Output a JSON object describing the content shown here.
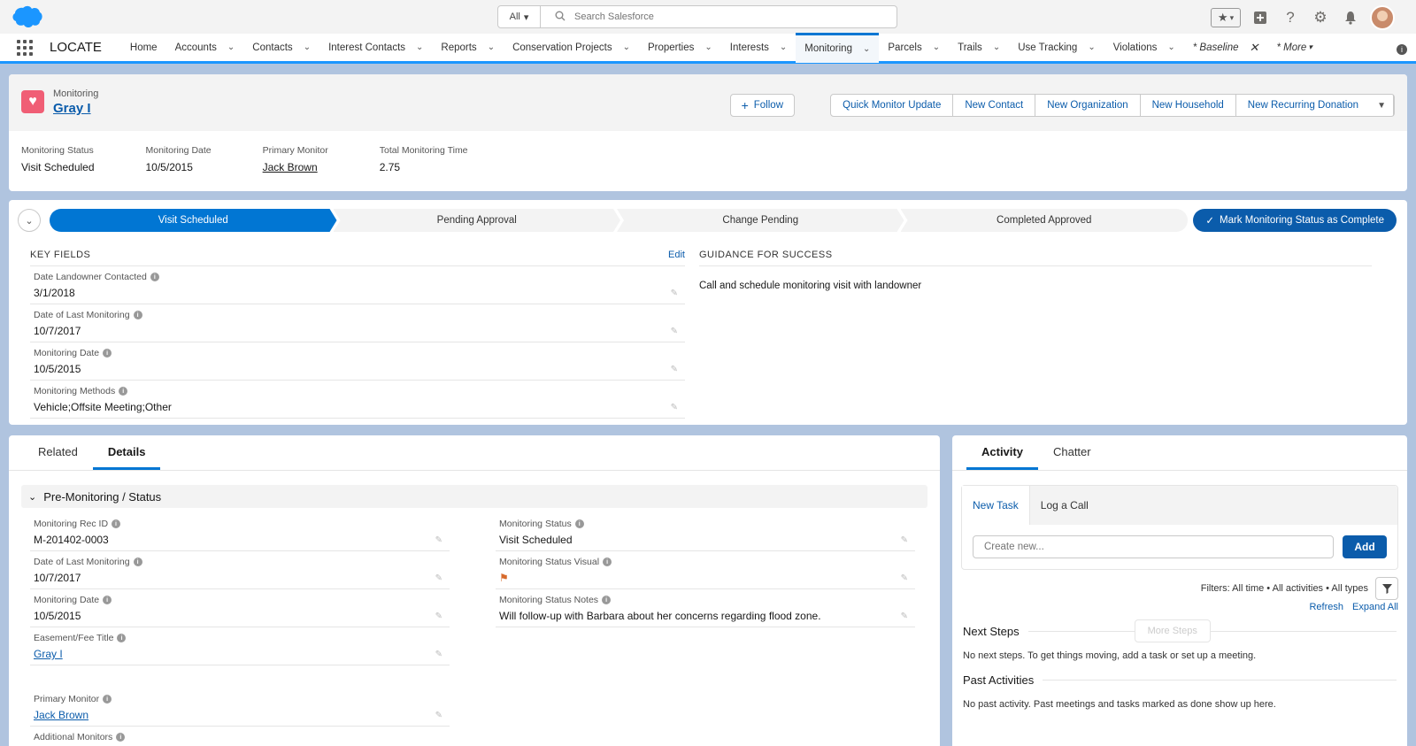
{
  "header": {
    "search_scope": "All",
    "search_placeholder": "Search Salesforce"
  },
  "nav": {
    "app_name": "LOCATE",
    "items": [
      {
        "label": "Home",
        "chevron": false
      },
      {
        "label": "Accounts",
        "chevron": true
      },
      {
        "label": "Contacts",
        "chevron": true
      },
      {
        "label": "Interest Contacts",
        "chevron": true
      },
      {
        "label": "Reports",
        "chevron": true
      },
      {
        "label": "Conservation Projects",
        "chevron": true
      },
      {
        "label": "Properties",
        "chevron": true
      },
      {
        "label": "Interests",
        "chevron": true
      },
      {
        "label": "Monitoring",
        "chevron": true
      },
      {
        "label": "Parcels",
        "chevron": true
      },
      {
        "label": "Trails",
        "chevron": true
      },
      {
        "label": "Use Tracking",
        "chevron": true
      },
      {
        "label": "Violations",
        "chevron": true
      }
    ],
    "temp_tab": "* Baseline",
    "more": "* More"
  },
  "record": {
    "type": "Monitoring",
    "name": "Gray I",
    "follow_label": "Follow",
    "actions": [
      "Quick Monitor Update",
      "New Contact",
      "New Organization",
      "New Household",
      "New Recurring Donation"
    ],
    "highlights": [
      {
        "label": "Monitoring Status",
        "value": "Visit Scheduled",
        "link": false
      },
      {
        "label": "Monitoring Date",
        "value": "10/5/2015",
        "link": false
      },
      {
        "label": "Primary Monitor",
        "value": "Jack Brown",
        "link": true
      },
      {
        "label": "Total Monitoring Time",
        "value": "2.75",
        "link": false
      }
    ]
  },
  "path": {
    "stages": [
      "Visit Scheduled",
      "Pending Approval",
      "Change Pending",
      "Completed Approved"
    ],
    "current_index": 0,
    "mark_complete_label": "Mark Monitoring Status as Complete"
  },
  "key_fields": {
    "title": "KEY FIELDS",
    "edit_label": "Edit",
    "fields": [
      {
        "label": "Date Landowner Contacted",
        "value": "3/1/2018"
      },
      {
        "label": "Date of Last Monitoring",
        "value": "10/7/2017"
      },
      {
        "label": "Monitoring Date",
        "value": "10/5/2015"
      },
      {
        "label": "Monitoring Methods",
        "value": "Vehicle;Offsite Meeting;Other"
      }
    ]
  },
  "guidance": {
    "title": "GUIDANCE FOR SUCCESS",
    "text": "Call and schedule monitoring visit with landowner"
  },
  "details": {
    "tabs": [
      "Related",
      "Details"
    ],
    "active_tab": 1,
    "section_title": "Pre-Monitoring / Status",
    "left_fields": [
      {
        "label": "Monitoring Rec ID",
        "value": "M-201402-0003",
        "link": false
      },
      {
        "label": "Date of Last Monitoring",
        "value": "10/7/2017",
        "link": false
      },
      {
        "label": "Monitoring Date",
        "value": "10/5/2015",
        "link": false
      },
      {
        "label": "Easement/Fee Title",
        "value": "Gray I",
        "link": true
      },
      {
        "label": "",
        "value": "",
        "link": false
      },
      {
        "label": "Primary Monitor",
        "value": "Jack Brown",
        "link": true
      },
      {
        "label": "Additional Monitors",
        "value": "",
        "link": false
      }
    ],
    "right_fields": [
      {
        "label": "Monitoring Status",
        "value": "Visit Scheduled"
      },
      {
        "label": "Monitoring Status Visual",
        "value": "",
        "flag": true
      },
      {
        "label": "Monitoring Status Notes",
        "value": "Will follow-up with Barbara about her concerns regarding flood zone."
      }
    ]
  },
  "activity": {
    "tabs": [
      "Activity",
      "Chatter"
    ],
    "active_tab": 0,
    "publisher_tabs": [
      "New Task",
      "Log a Call"
    ],
    "create_placeholder": "Create new...",
    "add_label": "Add",
    "filters_text": "Filters: All time • All activities • All types",
    "refresh_label": "Refresh",
    "expand_label": "Expand All",
    "next_steps_title": "Next Steps",
    "more_steps_label": "More Steps",
    "next_steps_empty": "No next steps. To get things moving, add a task or set up a meeting.",
    "past_title": "Past Activities",
    "past_empty": "No past activity. Past meetings and tasks marked as done show up here."
  }
}
